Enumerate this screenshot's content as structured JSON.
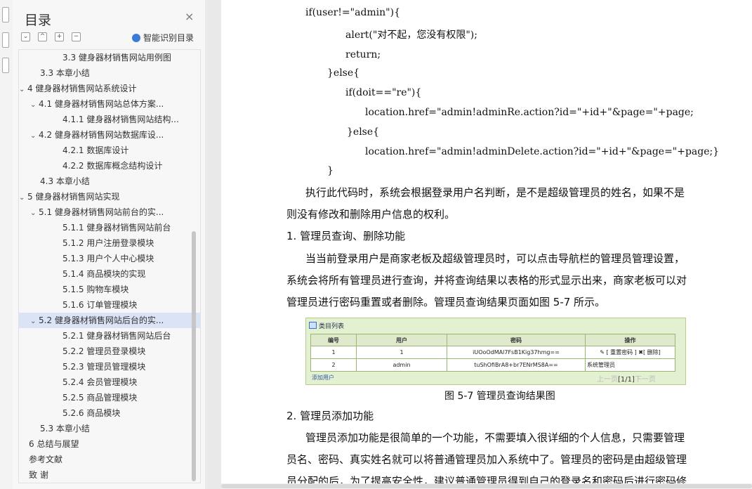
{
  "toc": {
    "title": "目录",
    "close": "×",
    "ai_label": "智能识别目录",
    "controls": [
      "⌄",
      "^",
      "+",
      "−"
    ],
    "items": [
      {
        "label": "3.3  健身器材销售网站用例图",
        "level": 2,
        "expandable": false
      },
      {
        "label": "3.3  本章小结",
        "level": 1,
        "expandable": false
      },
      {
        "label": "4  健身器材销售网站系统设计",
        "level": 0,
        "expandable": true
      },
      {
        "label": "4.1  健身器材销售网站总体方案...",
        "level": 1,
        "expandable": true
      },
      {
        "label": "4.1.1  健身器材销售网站结构...",
        "level": 2,
        "expandable": false
      },
      {
        "label": "4.2  健身器材销售网站数据库设...",
        "level": 1,
        "expandable": true
      },
      {
        "label": "4.2.1  数据库设计",
        "level": 2,
        "expandable": false
      },
      {
        "label": "4.2.2  数据库概念结构设计",
        "level": 2,
        "expandable": false
      },
      {
        "label": "4.3  本章小结",
        "level": 1,
        "expandable": false
      },
      {
        "label": "5  健身器材销售网站实现",
        "level": 0,
        "expandable": true
      },
      {
        "label": "5.1  健身器材销售网站前台的实...",
        "level": 1,
        "expandable": true
      },
      {
        "label": "5.1.1  健身器材销售网站前台",
        "level": 2,
        "expandable": false
      },
      {
        "label": "5.1.2 用户注册登录模块",
        "level": 2,
        "expandable": false
      },
      {
        "label": "5.1.3  用户个人中心模块",
        "level": 2,
        "expandable": false
      },
      {
        "label": "5.1.4  商品模块的实现",
        "level": 2,
        "expandable": false
      },
      {
        "label": "5.1.5  购物车模块",
        "level": 2,
        "expandable": false
      },
      {
        "label": "5.1.6  订单管理模块",
        "level": 2,
        "expandable": false
      },
      {
        "label": "5.2  健身器材销售网站后台的实...",
        "level": 1,
        "expandable": true,
        "active": true
      },
      {
        "label": "5.2.1  健身器材销售网站后台",
        "level": 2,
        "expandable": false
      },
      {
        "label": "5.2.2  管理员登录模块",
        "level": 2,
        "expandable": false
      },
      {
        "label": "5.2.3  管理员管理模块",
        "level": 2,
        "expandable": false
      },
      {
        "label": "5.2.4  会员管理模块",
        "level": 2,
        "expandable": false
      },
      {
        "label": "5.2.5  商品管理模块",
        "level": 2,
        "expandable": false
      },
      {
        "label": "5.2.6  商品模块",
        "level": 2,
        "expandable": false
      },
      {
        "label": "5.3  本章小结",
        "level": 1,
        "expandable": false
      },
      {
        "label": "6  总结与展望",
        "level": 0,
        "expandable": false
      },
      {
        "label": "参考文献",
        "level": 0,
        "expandable": false
      },
      {
        "label": "致    谢",
        "level": 0,
        "expandable": false
      }
    ]
  },
  "doc": {
    "code": [
      "if(user!=\"admin\"){",
      "alert(\"对不起，您没有权限\");",
      "return;",
      "}else{",
      "if(doit==\"re\"){",
      "location.href=\"admin!adminRe.action?id=\"+id+\"&page=\"+page;",
      "}else{",
      "location.href=\"admin!adminDelete.action?id=\"+id+\"&page=\"+page;}",
      "}"
    ],
    "p1": [
      "执行此代码时，系统会根据登录用户名判断，是不是超级管理员的姓名，如果不是",
      "则没有修改和删除用户信息的权利。"
    ],
    "h1": "1. 管理员查询、删除功能",
    "p2": [
      "当当前登录用户是商家老板及超级管理员时，可以点击导航栏的管理员管理设置，",
      "系统会将所有管理员进行查询，并将查询结果以表格的形式显示出来，商家老板可以对",
      "管理员进行密码重置或者删除。管理员查询结果页面如图 5-7 所示。"
    ],
    "caption": "图 5-7 管理员查询结果图",
    "h2": "2. 管理员添加功能",
    "p3": [
      "管理员添加功能是很简单的一个功能，不需要填入很详细的个人信息，只需要管理",
      "员名、密码、真实姓名就可以将普通管理员加入系统中了。管理员的密码是由超级管理",
      "员分配的后，为了提高安全性，建议普通管理员得到自己的登录名和密码后进行密码修"
    ]
  },
  "figure": {
    "title": "类目列表",
    "headers": [
      "编号",
      "用户",
      "密码",
      "操作"
    ],
    "rows": [
      [
        "1",
        "1",
        "iUOoOdMAl7FsB1Kig37hmg==",
        "✎ [ 重置密码 ] ✖[ 删除]"
      ],
      [
        "2",
        "admin",
        "tuShOfiBrA8+br7ENrMS8A==",
        "系统管理员"
      ]
    ],
    "add_user": "添加用户",
    "pager_prev": "上一页",
    "pager_page": "[1/1]",
    "pager_next": "下一页"
  }
}
